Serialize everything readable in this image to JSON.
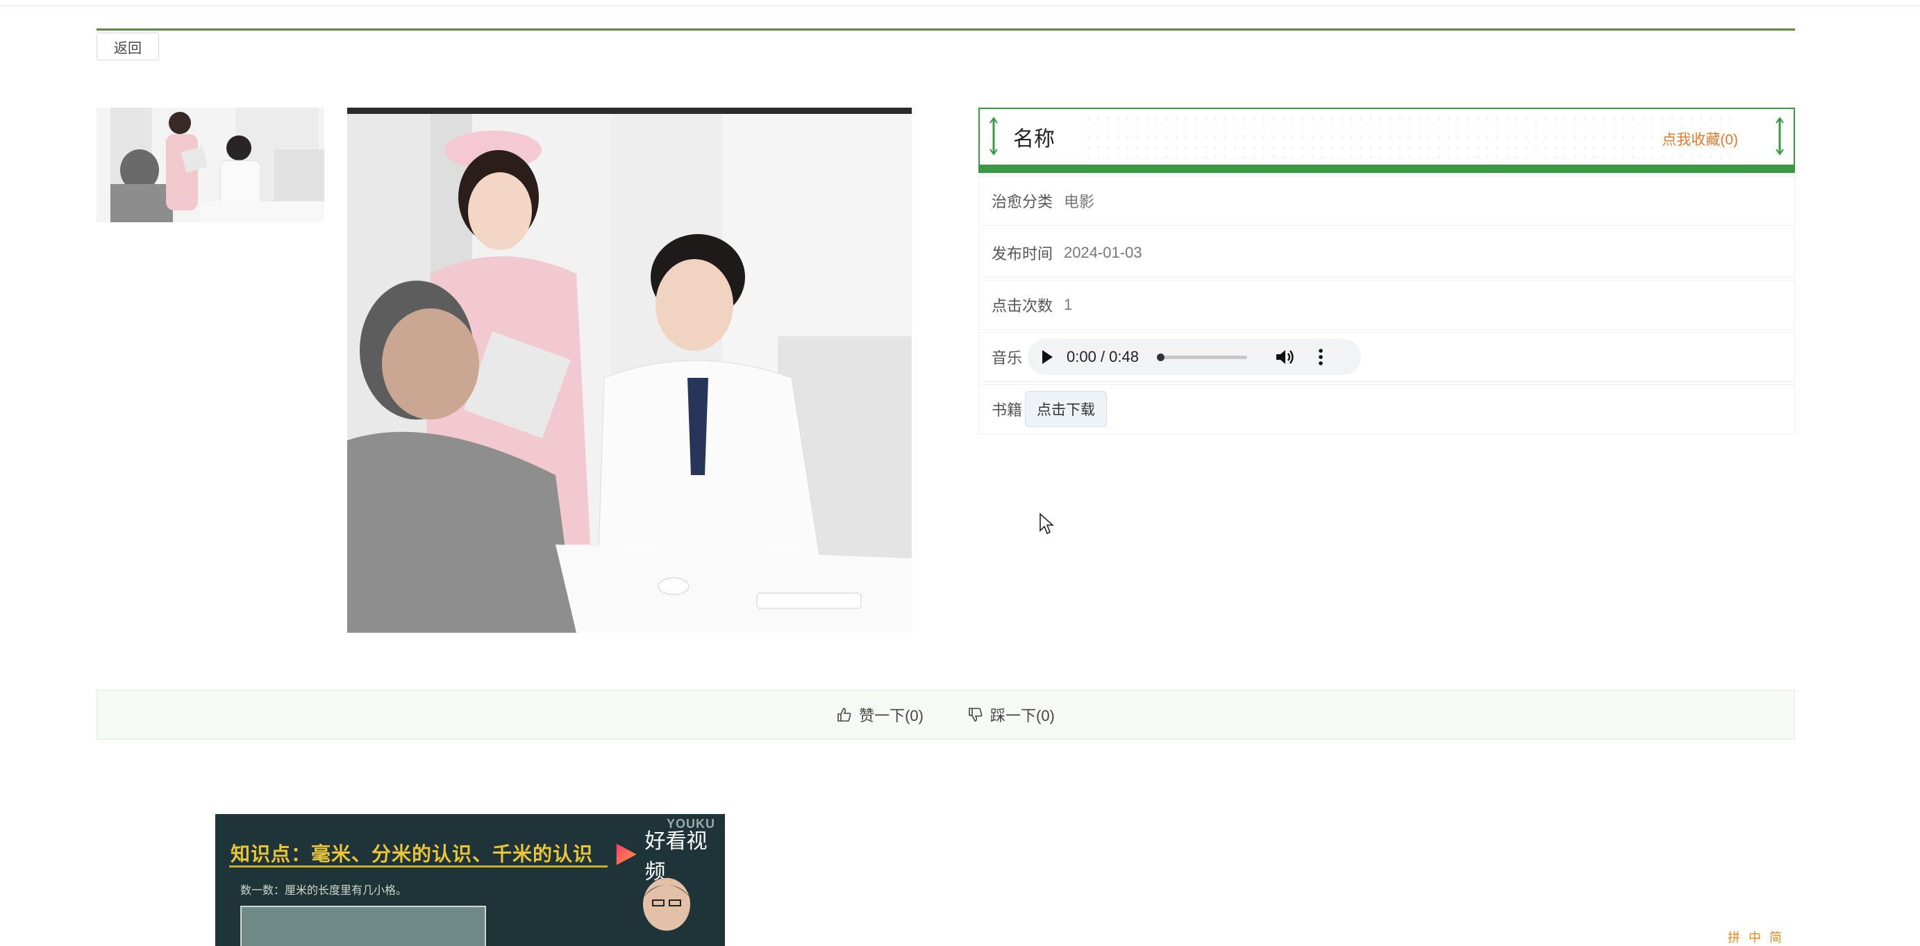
{
  "header": {
    "back_label": "返回"
  },
  "detail": {
    "title": "名称",
    "favorite_label": "点我收藏(0)",
    "fields": [
      {
        "label": "治愈分类",
        "value": "电影"
      },
      {
        "label": "发布时间",
        "value": "2024-01-03"
      },
      {
        "label": "点击次数",
        "value": "1"
      }
    ],
    "music": {
      "label": "音乐",
      "time": "0:00 / 0:48",
      "progress": 0.02
    },
    "book": {
      "label": "书籍",
      "download_label": "点击下载"
    }
  },
  "votes": {
    "like_label": "赞一下(0)",
    "dislike_label": "踩一下(0)"
  },
  "video": {
    "title_text": "知识点：毫米、分米的认识、千米的认识",
    "subtitle_text": "数一数：厘米的长度里有几小格。",
    "brand": "好看视频",
    "watermark": "YOUKU"
  },
  "tray": {
    "items": [
      "拼",
      "中",
      "简"
    ]
  },
  "colors": {
    "accent_green": "#3a9a44",
    "favorite_orange": "#e07a2f",
    "vote_bg": "#f5fbf4"
  }
}
